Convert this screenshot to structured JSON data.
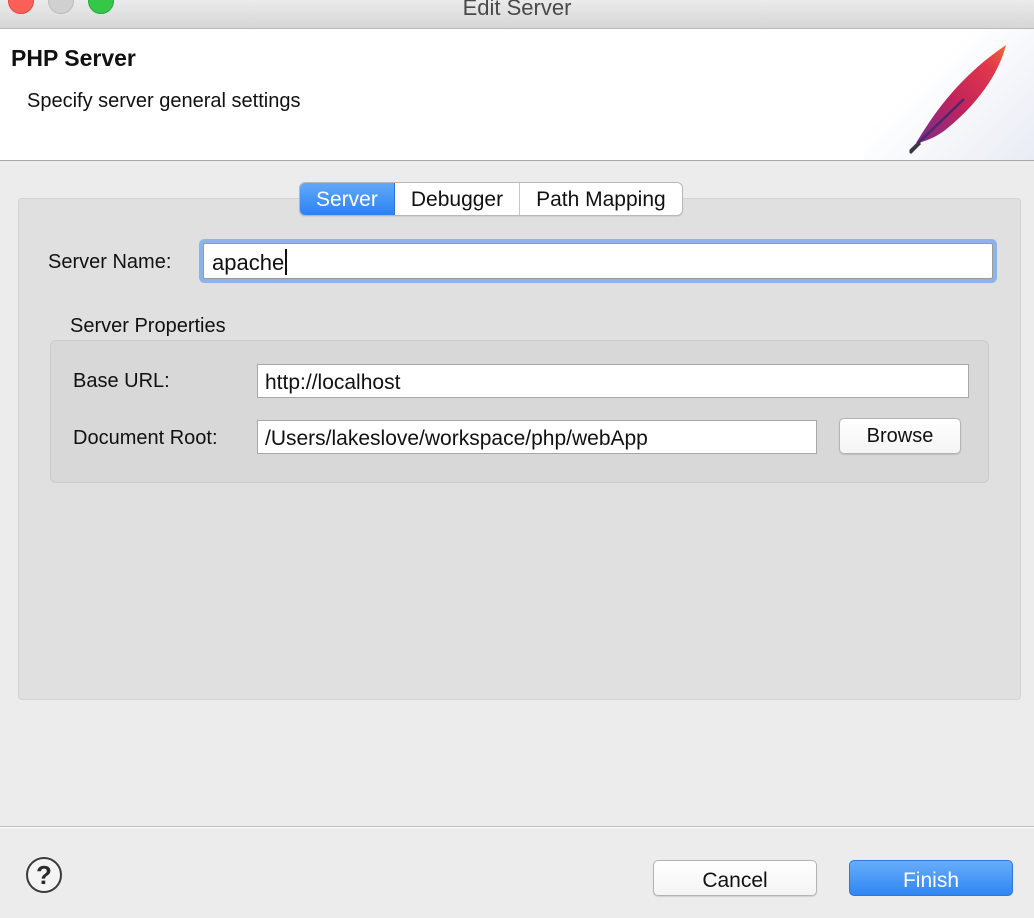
{
  "window": {
    "title": "Edit Server"
  },
  "header": {
    "title": "PHP Server",
    "subtitle": "Specify server general settings",
    "graphic_icon": "apache-feather-icon"
  },
  "tabs": [
    {
      "label": "Server",
      "active": true
    },
    {
      "label": "Debugger",
      "active": false
    },
    {
      "label": "Path Mapping",
      "active": false
    }
  ],
  "form": {
    "server_name_label": "Server Name:",
    "server_name_value": "apache",
    "server_properties": {
      "title": "Server Properties",
      "base_url_label": "Base URL:",
      "base_url_value": "http://localhost",
      "document_root_label": "Document Root:",
      "document_root_value": "/Users/lakeslove/workspace/php/webApp",
      "browse_label": "Browse"
    }
  },
  "footer": {
    "help_glyph": "?",
    "cancel_label": "Cancel",
    "finish_label": "Finish"
  },
  "colors": {
    "accent": "#2a83f3",
    "close": "#fc5f57",
    "maximize": "#34c748"
  }
}
